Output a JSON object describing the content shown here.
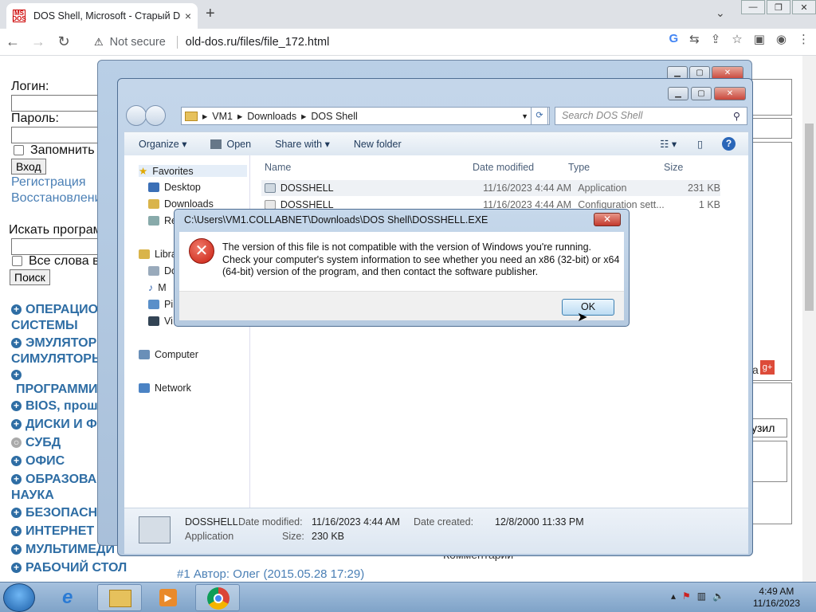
{
  "browser": {
    "tab_title": "DOS Shell, Microsoft - Старый D",
    "tab_favicon": "MS DOS",
    "tab_close": "×",
    "new_tab": "+",
    "security_label": "Not secure",
    "url": "old-dos.ru/files/file_172.html",
    "window_controls": [
      "—",
      "❐",
      "✕"
    ]
  },
  "page": {
    "login_label": "Логин:",
    "password_label": "Пароль:",
    "remember_label": "Запомнить",
    "login_button": "Вход",
    "register_link": "Регистрация",
    "restore_link": "Восстановлени",
    "search_label": "Искать програм",
    "all_words_label": "Все слова в",
    "search_button": "Поиск",
    "categories": [
      {
        "label": "ОПЕРАЦИО",
        "label2": "СИСТЕМЫ",
        "bullet": "+"
      },
      {
        "label": "ЭМУЛЯТОР",
        "label2": "СИМУЛЯТОРЫ",
        "bullet": "+"
      },
      {
        "label": "",
        "label2": "ПРОГРАММИ",
        "bullet": "+"
      },
      {
        "label": "BIOS, прош",
        "bullet": "+"
      },
      {
        "label": "ДИСКИ И Ф",
        "bullet": "+"
      },
      {
        "label": "СУБД",
        "bullet": "○"
      },
      {
        "label": "ОФИС",
        "bullet": "+"
      },
      {
        "label": "ОБРАЗОВА",
        "label2": "НАУКА",
        "bullet": "+"
      },
      {
        "label": "БЕЗОПАСН",
        "bullet": "+"
      },
      {
        "label": "ИНТЕРНЕТ",
        "bullet": "+"
      },
      {
        "label": "МУЛЬТИМЕДИ",
        "bullet": "+"
      },
      {
        "label": "РАБОЧИЙ СТОЛ",
        "bullet": "+"
      }
    ],
    "comment_author": "#1 Автор: Олег (2015.05.28 17:29)",
    "comments_heading": "Комментарии",
    "upload_fragment": "узил",
    "share_fragment": "а"
  },
  "explorer": {
    "breadcrumb": [
      "VM1",
      "Downloads",
      "DOS Shell"
    ],
    "search_placeholder": "Search DOS Shell",
    "toolbar": {
      "organize": "Organize ▾",
      "open": "Open",
      "share": "Share with ▾",
      "new_folder": "New folder"
    },
    "nav": {
      "favorites": "Favorites",
      "desktop": "Desktop",
      "downloads": "Downloads",
      "recent": "Re",
      "libraries": "Libra",
      "docs": "Do",
      "music": "M",
      "pictures": "Pi",
      "videos": "Vi",
      "computer": "Computer",
      "network": "Network"
    },
    "columns": {
      "name": "Name",
      "date": "Date modified",
      "type": "Type",
      "size": "Size"
    },
    "files": [
      {
        "name": "DOSSHELL",
        "date": "11/16/2023 4:44 AM",
        "type": "Application",
        "size": "231 KB"
      },
      {
        "name": "DOSSHELL",
        "date": "11/16/2023 4:44 AM",
        "type": "Configuration sett...",
        "size": "1 KB"
      }
    ],
    "details": {
      "name": "DOSSHELL",
      "kind": "Application",
      "modified_label": "Date modified:",
      "modified_value": "11/16/2023 4:44 AM",
      "size_label": "Size:",
      "size_value": "230 KB",
      "created_label": "Date created:",
      "created_value": "12/8/2000 11:33 PM"
    }
  },
  "dialog": {
    "title": "C:\\Users\\VM1.COLLABNET\\Downloads\\DOS Shell\\DOSSHELL.EXE",
    "message": "The version of this file is not compatible with the version of Windows you're running. Check your computer's system information to see whether you need an x86 (32-bit) or x64 (64-bit) version of the program, and then contact the software publisher.",
    "ok": "OK",
    "close": "✕",
    "error_glyph": "✕"
  },
  "taskbar": {
    "time": "4:49 AM",
    "date": "11/16/2023"
  }
}
